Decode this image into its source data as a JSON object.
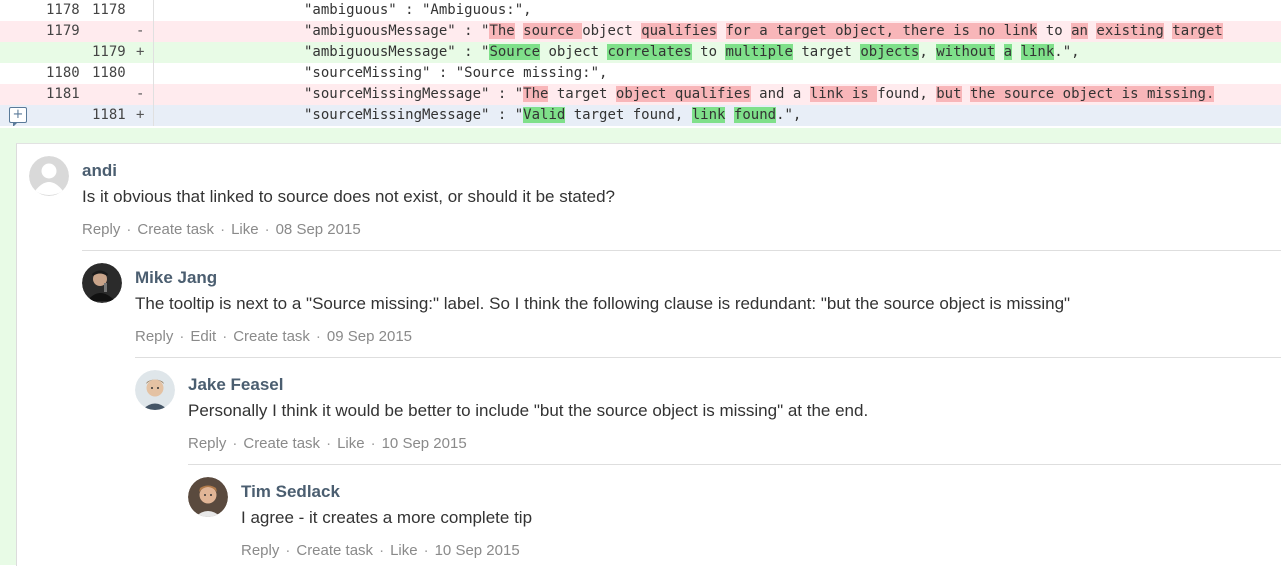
{
  "diff": {
    "lines": [
      {
        "kind": "ctx",
        "old": "1178",
        "new": "1178",
        "sign": "",
        "segments": [
          {
            "t": "\"ambiguous\" : \"Ambiguous:\",",
            "h": ""
          }
        ]
      },
      {
        "kind": "del",
        "old": "1179",
        "new": "",
        "sign": "-",
        "segments": [
          {
            "t": "\"ambiguousMessage\" : \"",
            "h": ""
          },
          {
            "t": "The",
            "h": "d"
          },
          {
            "t": " ",
            "h": ""
          },
          {
            "t": "source ",
            "h": "d"
          },
          {
            "t": "object ",
            "h": ""
          },
          {
            "t": "qualifies",
            "h": "d"
          },
          {
            "t": " ",
            "h": ""
          },
          {
            "t": "for a target object, there is no link",
            "h": "d"
          },
          {
            "t": " to ",
            "h": ""
          },
          {
            "t": "an",
            "h": "d"
          },
          {
            "t": " ",
            "h": ""
          },
          {
            "t": "existing",
            "h": "d"
          },
          {
            "t": " ",
            "h": ""
          },
          {
            "t": "target",
            "h": "d"
          }
        ]
      },
      {
        "kind": "add",
        "old": "",
        "new": "1179",
        "sign": "+",
        "segments": [
          {
            "t": "\"ambiguousMessage\" : \"",
            "h": ""
          },
          {
            "t": "Source",
            "h": "a"
          },
          {
            "t": " object ",
            "h": ""
          },
          {
            "t": "correlates",
            "h": "a"
          },
          {
            "t": " to ",
            "h": ""
          },
          {
            "t": "multiple",
            "h": "a"
          },
          {
            "t": " target ",
            "h": ""
          },
          {
            "t": "objects",
            "h": "a"
          },
          {
            "t": ", ",
            "h": ""
          },
          {
            "t": "without",
            "h": "a"
          },
          {
            "t": " ",
            "h": ""
          },
          {
            "t": "a",
            "h": "a"
          },
          {
            "t": " ",
            "h": ""
          },
          {
            "t": "link",
            "h": "a"
          },
          {
            "t": ".\",",
            "h": ""
          }
        ]
      },
      {
        "kind": "ctx",
        "old": "1180",
        "new": "1180",
        "sign": "",
        "segments": [
          {
            "t": "\"sourceMissing\" : \"Source missing:\",",
            "h": ""
          }
        ]
      },
      {
        "kind": "del",
        "old": "1181",
        "new": "",
        "sign": "-",
        "segments": [
          {
            "t": "\"sourceMissingMessage\" : \"",
            "h": ""
          },
          {
            "t": "The",
            "h": "d"
          },
          {
            "t": " target ",
            "h": ""
          },
          {
            "t": "object qualifies",
            "h": "d"
          },
          {
            "t": " and a ",
            "h": ""
          },
          {
            "t": "link is ",
            "h": "d"
          },
          {
            "t": "found, ",
            "h": ""
          },
          {
            "t": "but",
            "h": "d"
          },
          {
            "t": " ",
            "h": ""
          },
          {
            "t": "the source object is missing.",
            "h": "d"
          }
        ]
      },
      {
        "kind": "cur",
        "old": "",
        "new": "1181",
        "sign": "+",
        "segments": [
          {
            "t": "\"sourceMissingMessage\" : \"",
            "h": ""
          },
          {
            "t": "Valid",
            "h": "a"
          },
          {
            "t": " target found, ",
            "h": ""
          },
          {
            "t": "link",
            "h": "a"
          },
          {
            "t": " ",
            "h": ""
          },
          {
            "t": "found",
            "h": "a"
          },
          {
            "t": ".\",",
            "h": ""
          }
        ]
      }
    ]
  },
  "comments": [
    {
      "author": "andi",
      "body": "Is it obvious that linked to source does not exist, or should it be stated?",
      "actions": [
        "Reply",
        "Create task",
        "Like"
      ],
      "date": "08 Sep 2015",
      "avatar": "default"
    },
    {
      "author": "Mike Jang",
      "body": "The tooltip is next to a \"Source missing:\" label. So I think the following clause is redundant: \"but the source object is missing\"",
      "actions": [
        "Reply",
        "Edit",
        "Create task"
      ],
      "date": "09 Sep 2015",
      "avatar": "mike"
    },
    {
      "author": "Jake Feasel",
      "body": "Personally I think it would be better to include \"but the source object is missing\" at the end.",
      "actions": [
        "Reply",
        "Create task",
        "Like"
      ],
      "date": "10 Sep 2015",
      "avatar": "jake"
    },
    {
      "author": "Tim Sedlack",
      "body": "I agree - it creates a more complete tip",
      "actions": [
        "Reply",
        "Create task",
        "Like"
      ],
      "date": "10 Sep 2015",
      "avatar": "tim"
    }
  ],
  "colors": {
    "deleted_highlight": "#f8b6b9",
    "added_highlight": "#7fe08a",
    "author": "#4b5e70"
  }
}
